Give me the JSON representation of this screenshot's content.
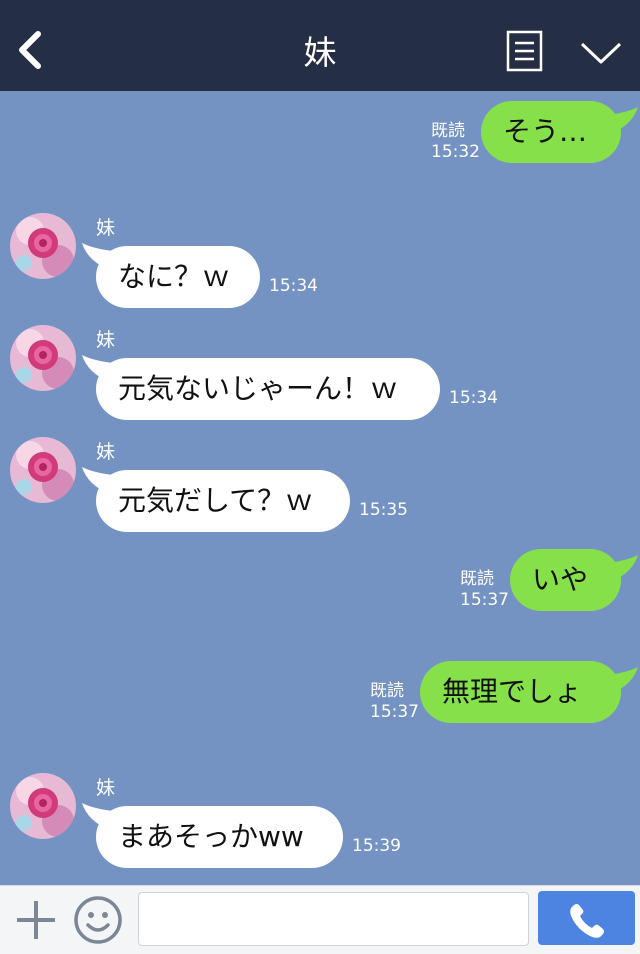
{
  "header": {
    "title": "妹",
    "back_icon": "chevron-left-icon",
    "menu_icon": "document-list-icon",
    "collapse_icon": "chevron-down-icon",
    "background": "#242f45"
  },
  "chat": {
    "background": "#7493c3",
    "outgoing_color": "#86e049",
    "incoming_color": "#ffffff",
    "messages": [
      {
        "direction": "outgoing",
        "text": "そう…",
        "read_label": "既読",
        "time": "15:32"
      },
      {
        "direction": "incoming",
        "sender": "妹",
        "text": "なに？ｗ",
        "time": "15:34"
      },
      {
        "direction": "incoming",
        "sender": "妹",
        "text": "元気ないじゃーん！ｗ",
        "time": "15:34"
      },
      {
        "direction": "incoming",
        "sender": "妹",
        "text": "元気だして？ｗ",
        "time": "15:35"
      },
      {
        "direction": "outgoing",
        "text": "いや",
        "read_label": "既読",
        "time": "15:37"
      },
      {
        "direction": "outgoing",
        "text": "無理でしょ",
        "read_label": "既読",
        "time": "15:37"
      },
      {
        "direction": "incoming",
        "sender": "妹",
        "text": "まあそっかww",
        "time": "15:39"
      }
    ]
  },
  "composer": {
    "plus_icon": "plus-icon",
    "emoji_icon": "smiley-icon",
    "input_value": "",
    "call_icon": "phone-icon",
    "call_color": "#4d84e1"
  }
}
